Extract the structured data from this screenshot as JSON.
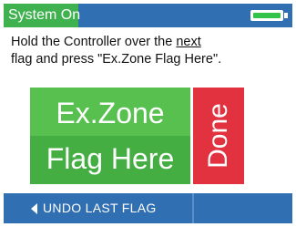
{
  "status_bar": {
    "label": "System On",
    "battery_icon": "battery-icon",
    "battery_level": 1.0,
    "colors": {
      "bar": "#2f6fb2",
      "label_bg": "#3fb24f",
      "battery_fill": "#33c24a"
    }
  },
  "instruction": {
    "line1_before": "Hold the Controller over the ",
    "line1_underlined": "next",
    "line2": "flag and press \"Ex.Zone Flag Here\"."
  },
  "flag_button": {
    "line1": "Ex.Zone",
    "line2": "Flag Here",
    "color": "#4cb848"
  },
  "done_button": {
    "label": "Done",
    "color": "#e2313f"
  },
  "bottom_bar": {
    "undo_icon": "chevron-left-icon",
    "undo_label": "UNDO LAST FLAG"
  }
}
